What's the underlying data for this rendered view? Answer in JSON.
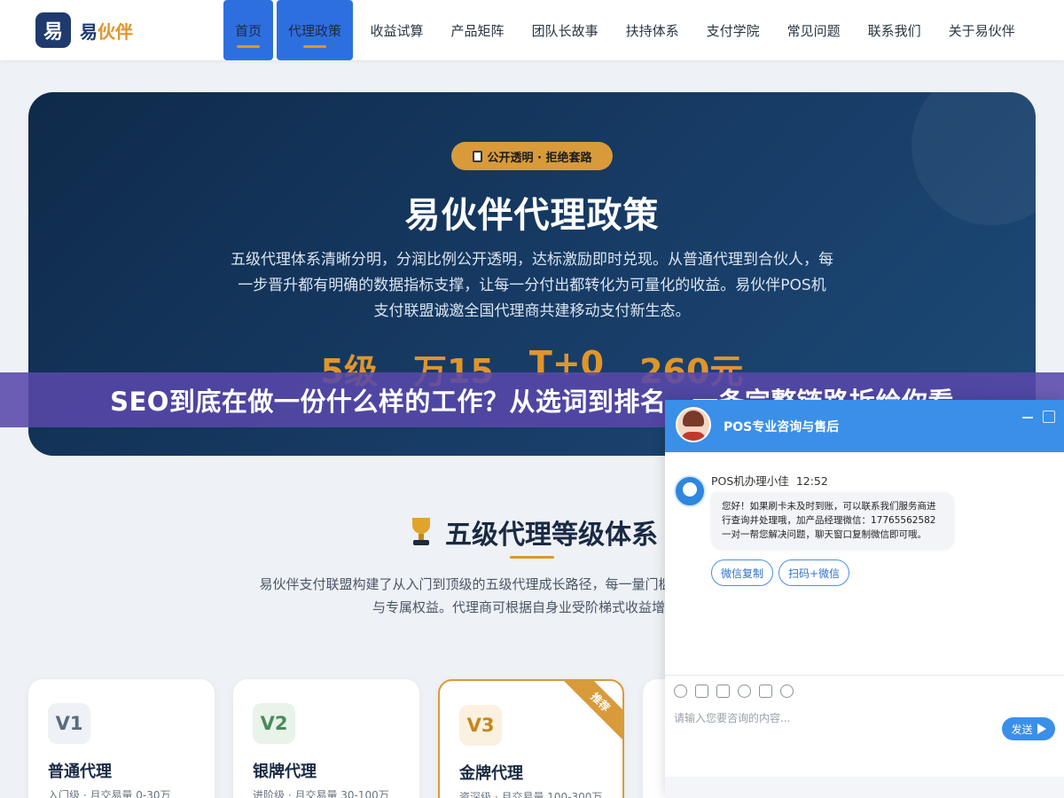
{
  "nav": {
    "logo_mark": "易",
    "logo_text_main": "易",
    "logo_text_accent": "伙伴",
    "items": [
      {
        "label": "首页",
        "active": true
      },
      {
        "label": "代理政策",
        "active": true
      },
      {
        "label": "收益试算",
        "active": false
      },
      {
        "label": "产品矩阵",
        "active": false
      },
      {
        "label": "团队长故事",
        "active": false
      },
      {
        "label": "扶持体系",
        "active": false
      },
      {
        "label": "支付学院",
        "active": false
      },
      {
        "label": "常见问题",
        "active": false
      },
      {
        "label": "联系我们",
        "active": false
      },
      {
        "label": "关于易伙伴",
        "active": false
      }
    ]
  },
  "hero": {
    "badge": "公开透明 · 拒绝套路",
    "title": "易伙伴代理政策",
    "description": "五级代理体系清晰分明，分润比例公开透明，达标激励即时兑现。从普通代理到合伙人，每一步晋升都有明确的数据指标支撑，让每一分付出都转化为可量化的收益。易伙伴POS机支付联盟诚邀全国代理商共建移动支付新生态。",
    "stats": [
      "5级",
      "万15",
      "T+0",
      "260元"
    ]
  },
  "seo_bar": "SEO到底在做一份什么样的工作？从选词到排名，一条完整链路拆给你看",
  "section": {
    "title": "五级代理等级体系",
    "description": "易伙伴支付联盟构建了从入门到顶级的五级代理成长路径，每一量门槛、分润比例、激活奖励与专属权益。代理商可根据自身业受阶梯式收益增长。"
  },
  "cards": [
    {
      "level": "V1",
      "name": "普通代理",
      "desc": "入门级 · 月交易量 0-30万",
      "color": "#5a6a80",
      "bg": "#eef1f5",
      "featured": false
    },
    {
      "level": "V2",
      "name": "银牌代理",
      "desc": "进阶级 · 月交易量 30-100万",
      "color": "#4a8a5a",
      "bg": "#e8f3ea",
      "featured": false
    },
    {
      "level": "V3",
      "name": "金牌代理",
      "desc": "资深级 · 月交易量 100-300万",
      "color": "#c8861a",
      "bg": "#fbf1e0",
      "featured": true,
      "ribbon": "推荐"
    }
  ],
  "chat": {
    "header_title": "POS专业咨询与售后",
    "agent_name": "POS机办理小佳",
    "time": "12:52",
    "message": "您好！如果刷卡未及时到账，可以联系我们服务商进行查询并处理哦，加产品经理微信：17765562582 一对一帮您解决问题，聊天窗口复制微信即可哦。",
    "buttons": [
      "微信复制",
      "扫码+微信"
    ],
    "input_placeholder": "请输入您要咨询的内容...",
    "send_label": "发送"
  }
}
